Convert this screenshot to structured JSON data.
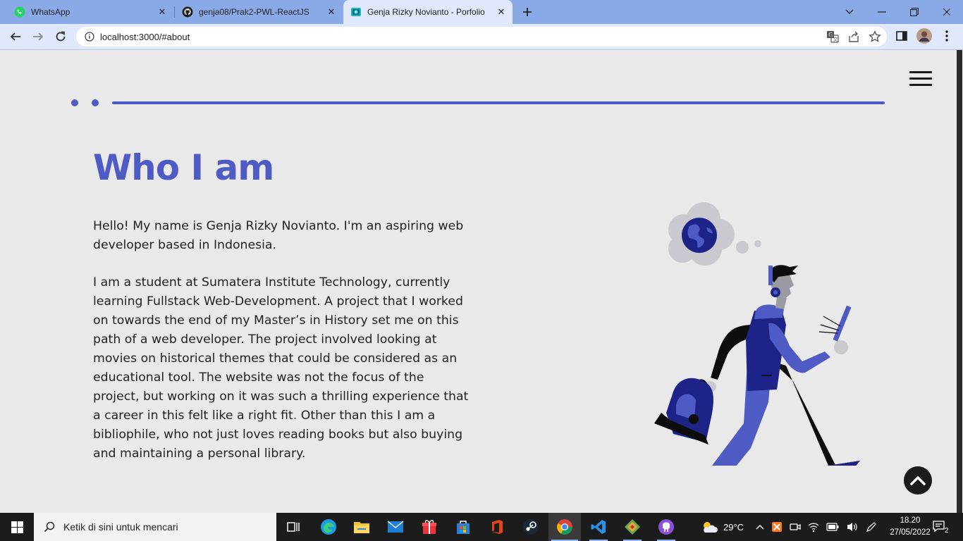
{
  "browser": {
    "tabs": [
      {
        "title": "WhatsApp",
        "favicon": "whatsapp-icon",
        "active": false
      },
      {
        "title": "genja08/Prak2-PWL-ReactJS",
        "favicon": "github-icon",
        "active": false
      },
      {
        "title": "Genja Rizky Novianto - Porfolio",
        "favicon": "site-icon",
        "active": true
      }
    ],
    "url": "localhost:3000/#about"
  },
  "page": {
    "heading": "Who I am",
    "paragraph1": "Hello! My name is Genja Rizky Novianto. I'm an aspiring web developer based in Indonesia.",
    "paragraph2": "I am a student at Sumatera Institute Technology, currently learning Fullstack Web-Development. A project that I worked on towards the end of my Master’s in History set me on this path of a web developer. The project involved looking at movies on historical themes that could be considered as an educational tool. The website was not the focus of the project, but working on it was such a thrilling experience that a career in this felt like a right fit. Other than this I am a bibliophile, who not just loves reading books but also buying and maintaining a personal library.",
    "accent_color": "#4f5bc5"
  },
  "taskbar": {
    "search_placeholder": "Ketik di sini untuk mencari",
    "weather": "29°C",
    "time": "18.20",
    "date": "27/05/2022",
    "notification_count": "2"
  }
}
